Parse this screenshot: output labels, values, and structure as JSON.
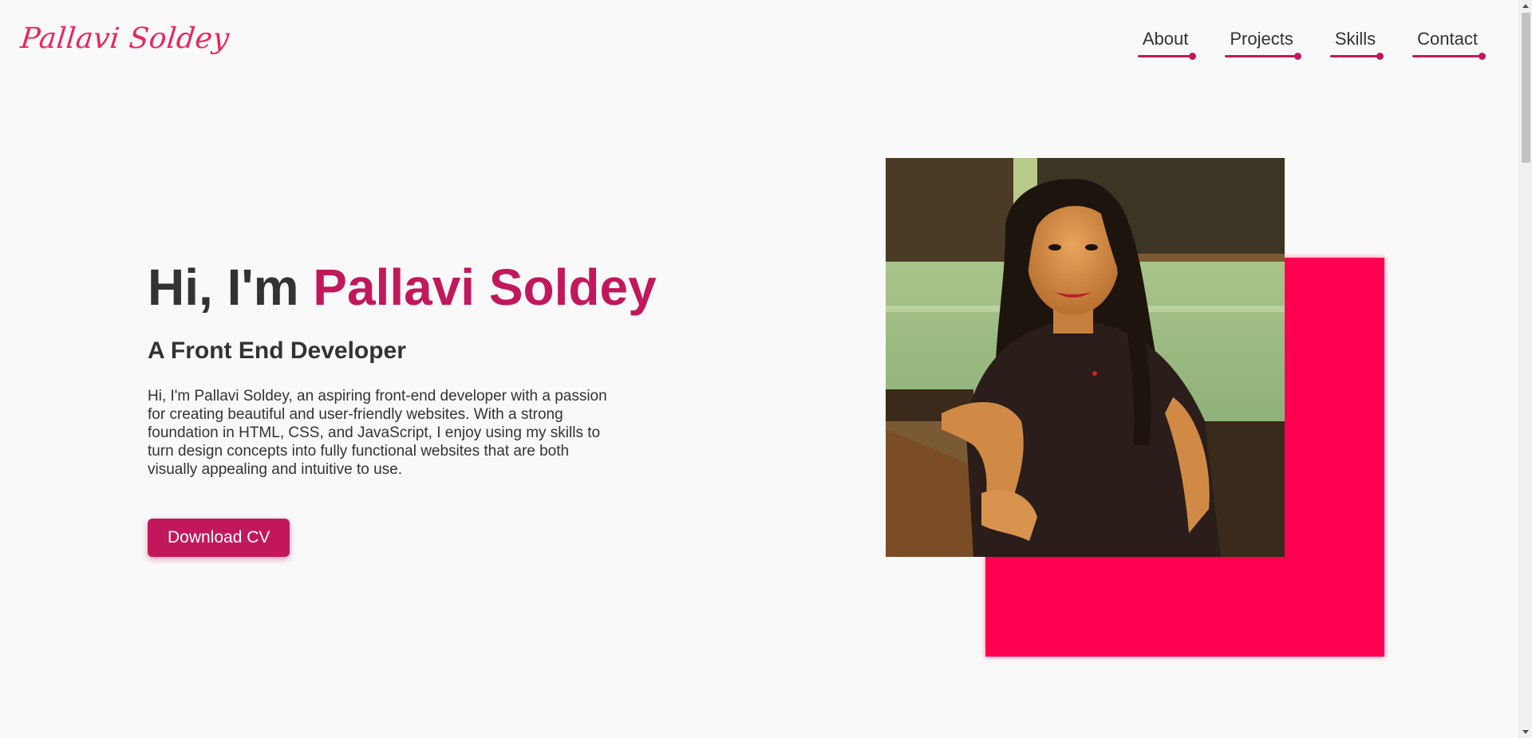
{
  "header": {
    "logo": "Pallavi Soldey",
    "nav": [
      {
        "label": "About"
      },
      {
        "label": "Projects"
      },
      {
        "label": "Skills"
      },
      {
        "label": "Contact"
      }
    ]
  },
  "hero": {
    "greeting": "Hi, I'm ",
    "name": "Pallavi Soldey",
    "subtitle": "A Front End Developer",
    "description": "Hi, I'm Pallavi Soldey, an aspiring front-end developer with a passion for creating beautiful and user-friendly websites. With a strong foundation in HTML, CSS, and JavaScript, I enjoy using my skills to turn design concepts into fully functional websites that are both visually appealing and intuitive to use.",
    "cta_label": "Download CV"
  },
  "colors": {
    "accent": "#c2185b",
    "logo": "#e8275f",
    "accent_square": "#ff0050",
    "background": "#f9f9f9",
    "text": "#333333"
  }
}
